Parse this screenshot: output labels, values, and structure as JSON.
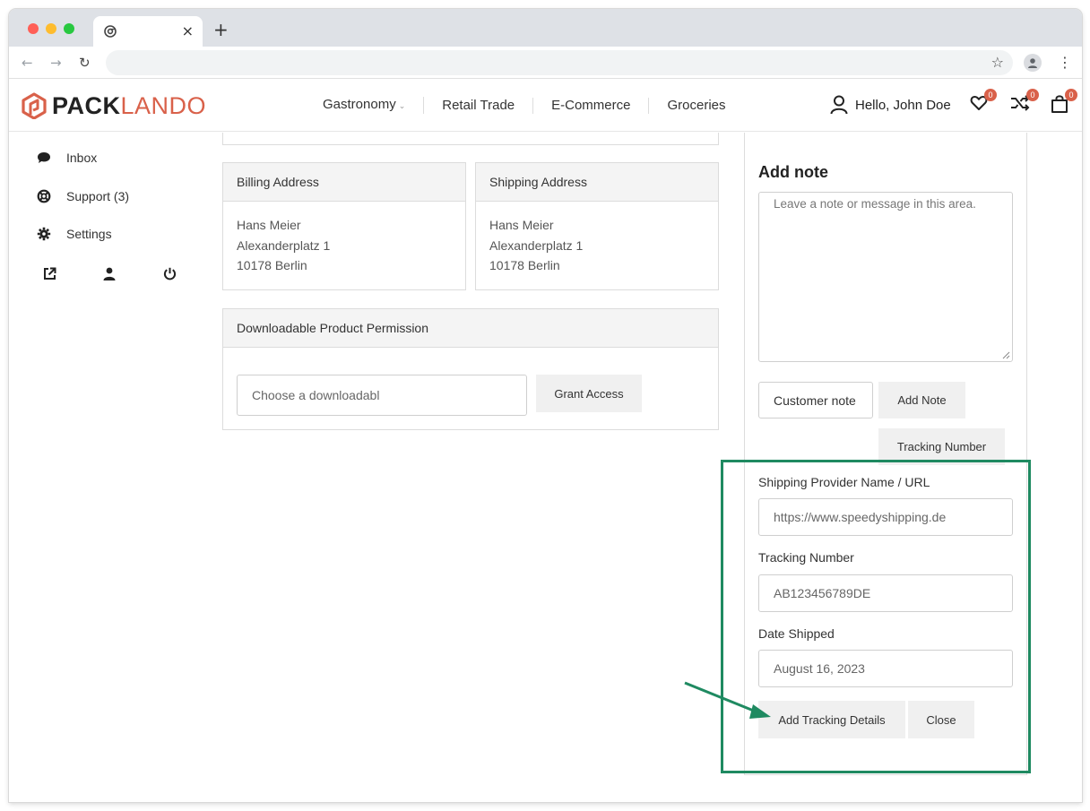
{
  "browser": {
    "tab_close": "×",
    "new_tab": "+",
    "back": "←",
    "forward": "→",
    "reload": "↻",
    "bookmark_star": "☆",
    "menu": "⋮",
    "address": ""
  },
  "header": {
    "logo_part1": "PACK",
    "logo_part2": "LANDO",
    "nav": [
      {
        "label": "Gastronomy",
        "has_dropdown": true
      },
      {
        "label": "Retail Trade"
      },
      {
        "label": "E-Commerce"
      },
      {
        "label": "Groceries"
      }
    ],
    "greeting": "Hello, John Doe",
    "wishlist_count": "0",
    "compare_count": "0",
    "cart_count": "0"
  },
  "sidebar": {
    "items": [
      {
        "label": "Inbox",
        "icon": "chat-bubble-icon"
      },
      {
        "label": "Support (3)",
        "icon": "lifebuoy-icon"
      },
      {
        "label": "Settings",
        "icon": "gear-icon"
      }
    ],
    "actions": [
      "external-link-icon",
      "user-icon",
      "power-icon"
    ]
  },
  "billing": {
    "title": "Billing Address",
    "name": "Hans Meier",
    "street": "Alexanderplatz 1",
    "city": "10178 Berlin"
  },
  "shipping": {
    "title": "Shipping Address",
    "name": "Hans Meier",
    "street": "Alexanderplatz 1",
    "city": "10178 Berlin"
  },
  "download": {
    "title": "Downloadable Product Permission",
    "select_placeholder": "Choose a downloadabl",
    "grant_label": "Grant Access"
  },
  "note_panel": {
    "title": "Add note",
    "placeholder": "Leave a note or message in this area.",
    "note_type": "Customer note",
    "add_note_label": "Add Note",
    "tracking_button_label": "Tracking Number"
  },
  "tracking": {
    "provider_label": "Shipping Provider Name / URL",
    "provider_value": "https://www.speedyshipping.de",
    "number_label": "Tracking Number",
    "number_value": "AB123456789DE",
    "date_label": "Date Shipped",
    "date_value": "August 16, 2023",
    "add_label": "Add Tracking Details",
    "close_label": "Close"
  },
  "colors": {
    "brand": "#d9614a",
    "highlight": "#1f8a61"
  }
}
